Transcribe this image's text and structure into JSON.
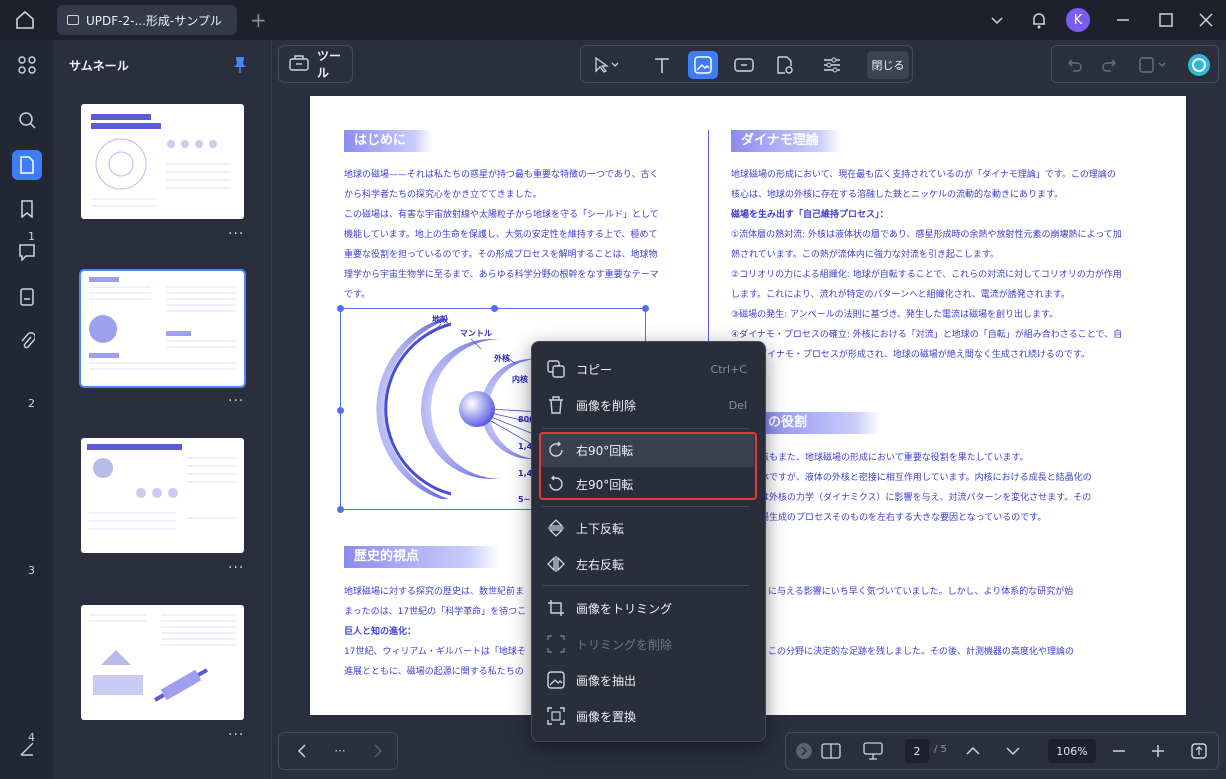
{
  "titlebar": {
    "tab_title": "UPDF-2-...形成-サンプル",
    "avatar_letter": "K"
  },
  "sidebar": {
    "header": "サムネール",
    "pages": [
      {
        "num": "1",
        "more": "···"
      },
      {
        "num": "2",
        "more": "···"
      },
      {
        "num": "3",
        "more": "···"
      },
      {
        "num": "4",
        "more": "···"
      }
    ]
  },
  "toolbar": {
    "tools_label": "ツール",
    "close_label": "閉じる"
  },
  "document": {
    "sec1_title": "はじめに",
    "sec1_lines": [
      "地球の磁場——それは私たちの惑星が持つ最も重要な特徴の一つであり、古く",
      "から科学者たちの探究心をかき立ててきました。",
      "この磁場は、有害な宇宙放射線や太陽粒子から地球を守る「シールド」として",
      "機能しています。地上の生命を保護し、大気の安定性を維持する上で、極めて",
      "重要な役割を担っているのです。その形成プロセスを解明することは、地球物",
      "理学から宇宙生物学に至るまで、あらゆる科学分野の根幹をなす重要なテーマ",
      "です。"
    ],
    "diagram_labels": {
      "crust": "地殻",
      "mantle": "マントル",
      "outer_core": "外核",
      "inner_core": "内核",
      "d1": "800",
      "d2": "1,40",
      "d3": "1,40",
      "d4": "5~"
    },
    "sec2_title": "歴史的視点",
    "sec2_lines": [
      "地球磁場に対する探究の歴史は、数世紀前ま",
      "まったのは、17世紀の「科学革命」を待つこ"
    ],
    "sec2_sub": "巨人と知の進化：",
    "sec2_lines2": [
      "17世紀、ウィリアム・ギルバートは「地球そ",
      "進展とともに、磁場の起源に関する私たちの"
    ],
    "sec3_title": "ダイナモ理論",
    "sec3_lines": [
      "地球磁場の形成において、現在最も広く支持されているのが「ダイナモ理論」です。この理論の",
      "核心は、地球の外核に存在する溶融した鉄とニッケルの流動的な動きにあります。"
    ],
    "sec3_sub": "磁場を生み出す「自己維持プロセス」：",
    "sec3_lines2": [
      "①流体層の熱対流: 外核は液体状の層であり、感星形成時の余熱や放射性元素の崩壊熱によって加",
      "熱されています。この熱が流体内に強力な対流を引き起こします。",
      "②コリオリの力による組織化: 地球が自転することで、これらの対流に対してコリオリの力が作用",
      "します。これにより、流れが特定のパターンへと組織化され、電流が誘発されます。",
      "③磁場の発生: アンペールの法則に基づき、発生した電流は磁場を創り出します。",
      "④ダイナモ・プロセスの確立: 外核における「対流」と地球の「自転」が組み合わさることで、自",
      "律的なダイナモ・プロセスが形成され、地球の磁場が絶え間なく生成され続けるのです。"
    ],
    "sec4_title": "の役割",
    "sec4_lines": [
      "核もまた、地球磁場の形成において重要な役割を果たしています。",
      "体ですが、液体の外核と密接に相互作用しています。内核における成長と結晶化の",
      "は外核の力学（ダイナミクス）に影響を与え、対流パターンを変化させます。その",
      "場生成のプロセスそのものを左右する大きな要因となっているのです。"
    ],
    "sec5_lines": [
      "に与える影響にいち早く気づいていました。しかし、より体系的な研究が始",
      "この分野に決定的な足跡を残しました。その後、計測機器の高度化や理論の"
    ]
  },
  "context_menu": {
    "copy": "コピー",
    "copy_shortcut": "Ctrl+C",
    "delete": "画像を削除",
    "delete_shortcut": "Del",
    "rotate_right": "右90°回転",
    "rotate_left": "左90°回転",
    "flip_v": "上下反転",
    "flip_h": "左右反転",
    "crop": "画像をトリミング",
    "remove_crop": "トリミングを削除",
    "extract": "画像を抽出",
    "replace": "画像を置換"
  },
  "bottom": {
    "page_current": "2",
    "page_total": "/ 5",
    "zoom": "106%",
    "more": "···"
  },
  "colors": {
    "accent": "#3d7df7",
    "highlight": "#e53935",
    "doc_text": "#3d3fd0"
  }
}
